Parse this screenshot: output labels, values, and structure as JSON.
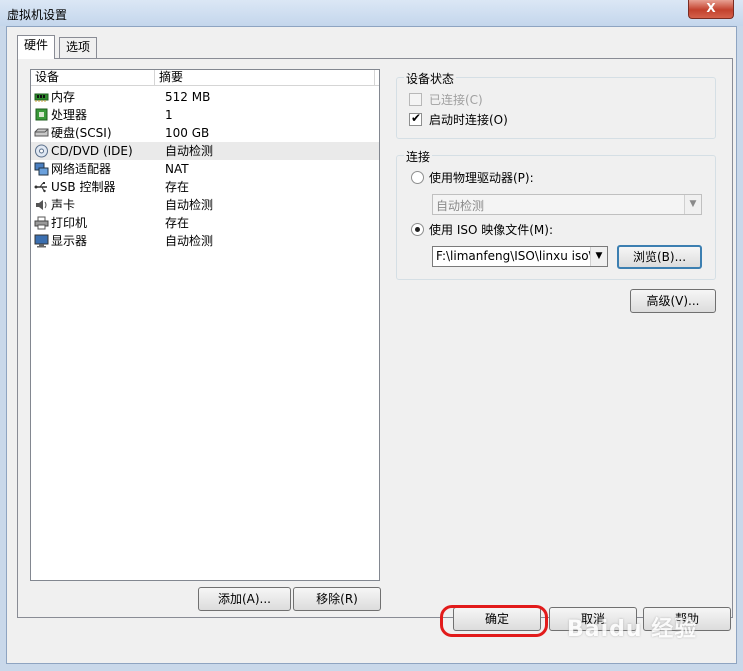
{
  "window": {
    "title": "虚拟机设置",
    "close_label": "X"
  },
  "tabs": [
    {
      "label": "硬件",
      "active": true
    },
    {
      "label": "选项",
      "active": false
    }
  ],
  "devices": {
    "columns": [
      "设备",
      "摘要"
    ],
    "rows": [
      {
        "name": "内存",
        "summary": "512 MB",
        "icon": "memory-icon"
      },
      {
        "name": "处理器",
        "summary": "1",
        "icon": "cpu-icon"
      },
      {
        "name": "硬盘(SCSI)",
        "summary": "100 GB",
        "icon": "hard-disk-icon"
      },
      {
        "name": "CD/DVD (IDE)",
        "summary": "自动检测",
        "icon": "cd-dvd-icon",
        "selected": true
      },
      {
        "name": "网络适配器",
        "summary": "NAT",
        "icon": "network-adapter-icon"
      },
      {
        "name": "USB 控制器",
        "summary": "存在",
        "icon": "usb-icon"
      },
      {
        "name": "声卡",
        "summary": "自动检测",
        "icon": "sound-card-icon"
      },
      {
        "name": "打印机",
        "summary": "存在",
        "icon": "printer-icon"
      },
      {
        "name": "显示器",
        "summary": "自动检测",
        "icon": "display-icon"
      }
    ]
  },
  "list_buttons": {
    "add": "添加(A)...",
    "remove": "移除(R)"
  },
  "device_status": {
    "group_label": "设备状态",
    "connected": {
      "label": "已连接(C)",
      "checked": false,
      "enabled": false
    },
    "connect_at_power_on": {
      "label": "启动时连接(O)",
      "checked": true,
      "enabled": true
    }
  },
  "connection": {
    "group_label": "连接",
    "physical_drive": {
      "label": "使用物理驱动器(P):",
      "selected": false,
      "value": "自动检测"
    },
    "iso_image": {
      "label": "使用 ISO 映像文件(M):",
      "selected": true,
      "value": "F:\\limanfeng\\ISO\\linxu iso\\lin"
    },
    "browse_label": "浏览(B)...",
    "advanced_label": "高级(V)..."
  },
  "dialog_buttons": {
    "ok": "确定",
    "cancel": "取消",
    "help": "帮助"
  },
  "watermark": "Baidu 经验",
  "colors": {
    "highlight": "#e21b1b",
    "default_button_border": "#3c7fb1",
    "title_bar": "#c4d6ec"
  }
}
